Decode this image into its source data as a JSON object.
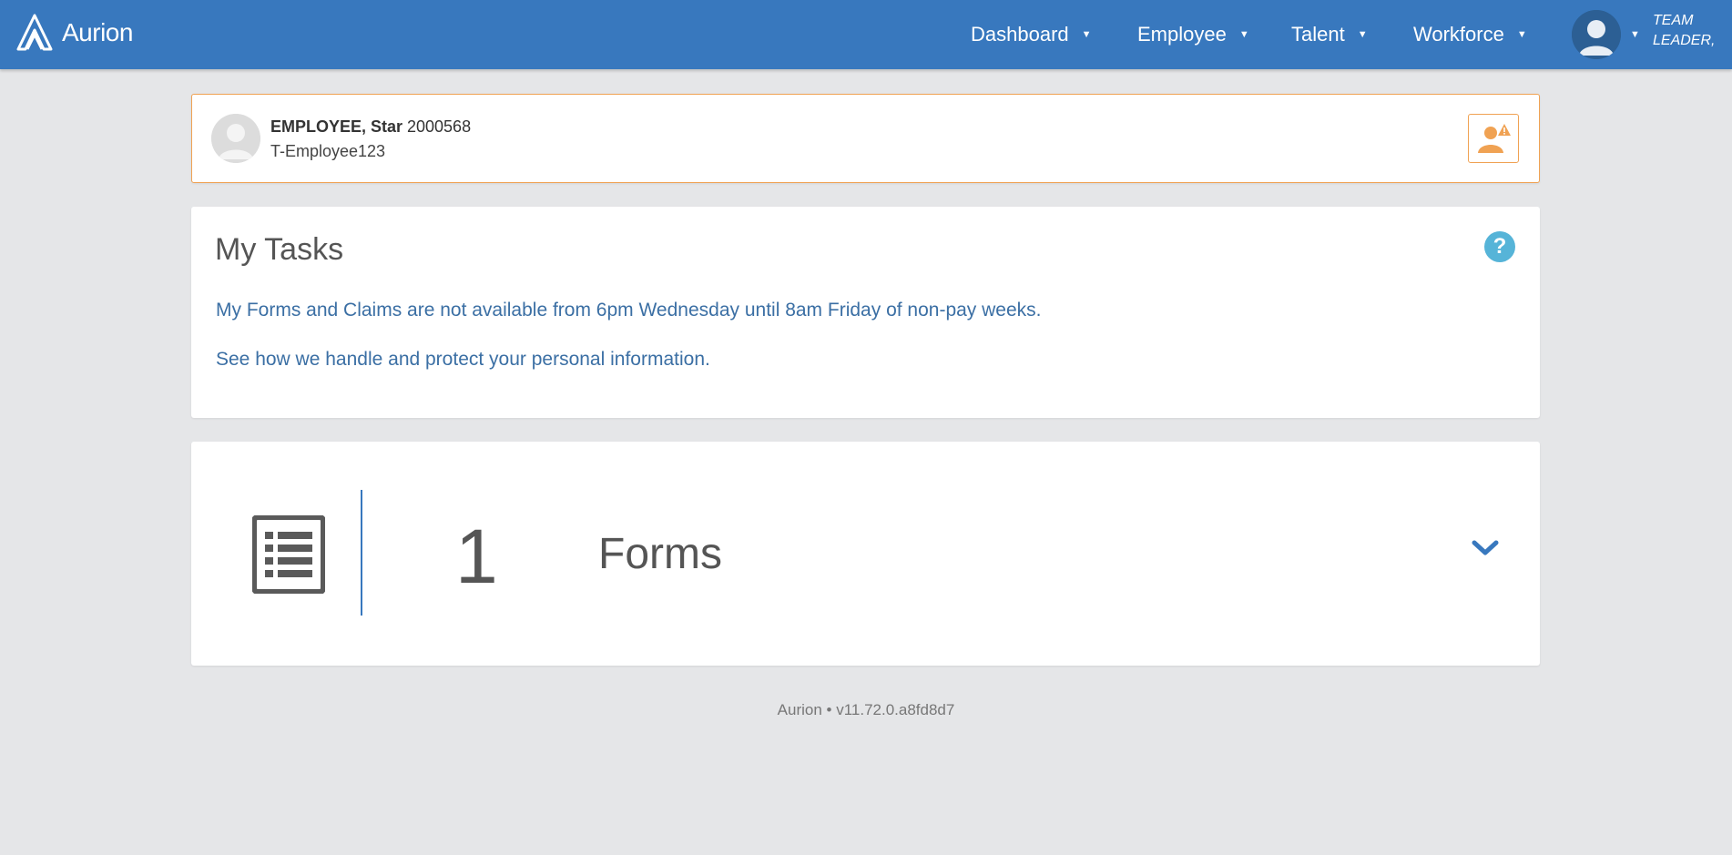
{
  "app": {
    "logo_text": "Aurion"
  },
  "nav": {
    "items": [
      {
        "label": "Dashboard"
      },
      {
        "label": "Employee"
      },
      {
        "label": "Talent"
      },
      {
        "label": "Workforce"
      }
    ],
    "user_role": "TEAM LEADER,"
  },
  "employee": {
    "name": "EMPLOYEE, Star",
    "number": "2000568",
    "login": "T-Employee123"
  },
  "tasks": {
    "title": "My Tasks",
    "notice": "My Forms and Claims are not available from 6pm Wednesday until 8am Friday of non-pay weeks.",
    "privacy_link": "See how we handle and protect your personal information."
  },
  "forms": {
    "count": "1",
    "label": "Forms"
  },
  "footer": {
    "version": "Aurion • v11.72.0.a8fd8d7"
  },
  "colors": {
    "header": "#3878be",
    "accent_orange": "#f0a253",
    "link_blue": "#3b6fa4",
    "help_blue": "#56b4d8"
  }
}
